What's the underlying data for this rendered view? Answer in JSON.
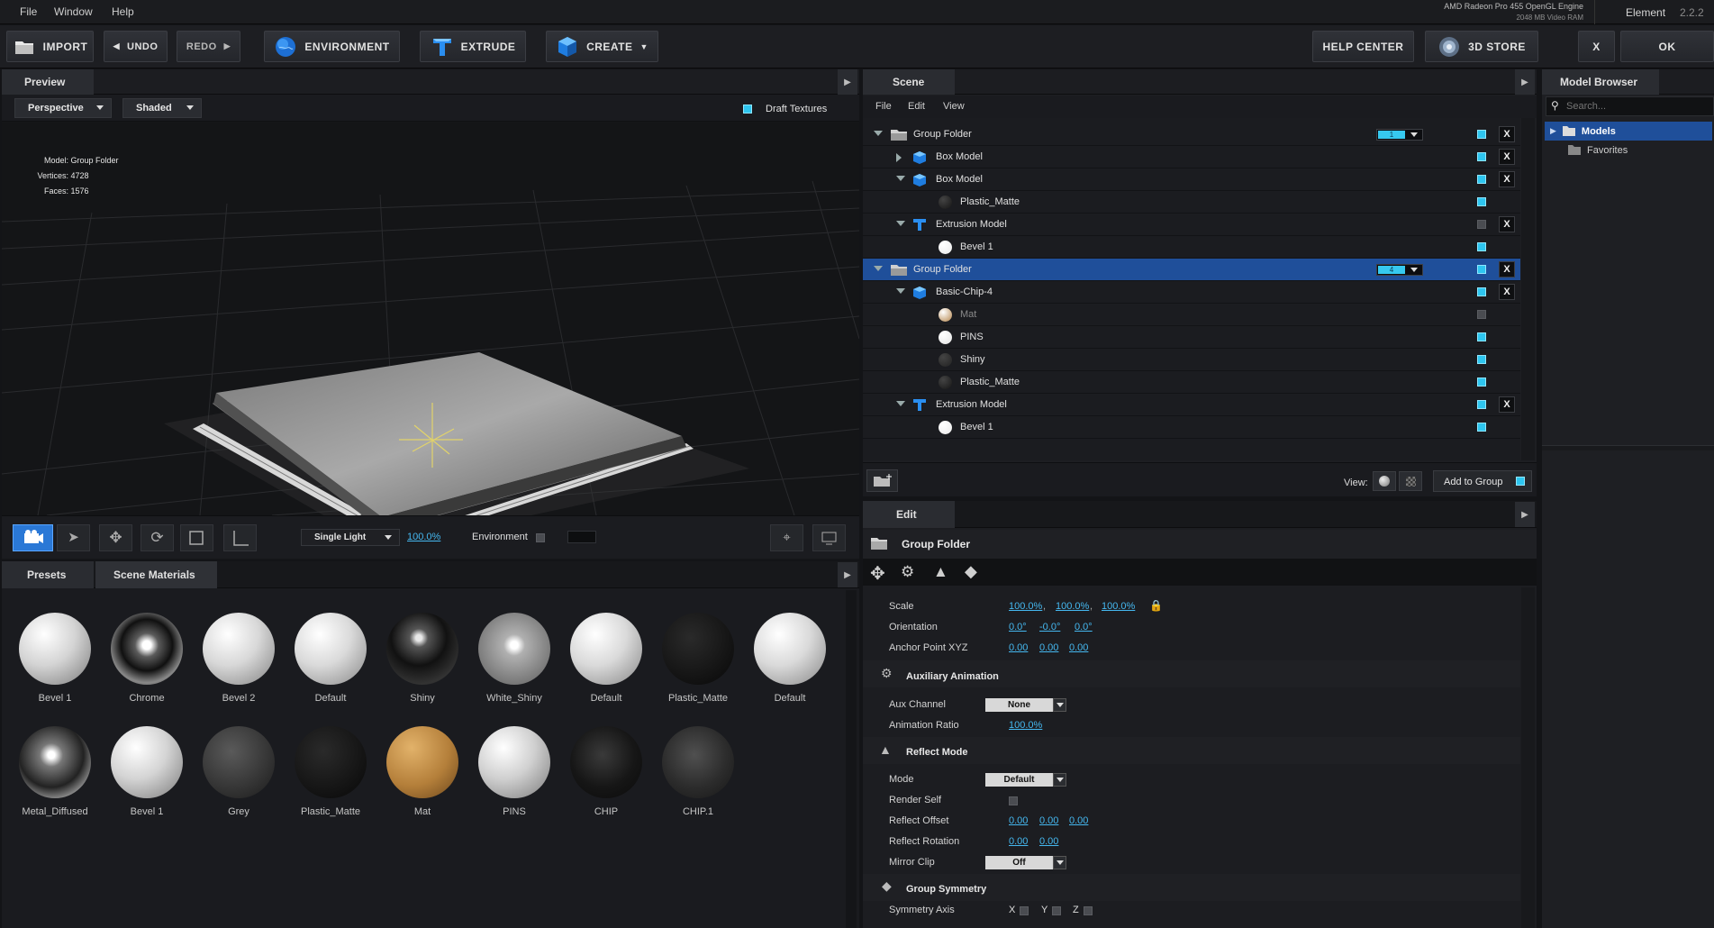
{
  "menubar": {
    "items": [
      "File",
      "Window",
      "Help"
    ],
    "gpu_name": "AMD Radeon Pro 455 OpenGL Engine",
    "gpu_ram": "2048 MB Video RAM",
    "app_name": "Element",
    "app_version": "2.2.2"
  },
  "toolbar": {
    "import": "IMPORT",
    "undo": "UNDO",
    "redo": "REDO",
    "environment": "ENVIRONMENT",
    "extrude": "EXTRUDE",
    "create": "CREATE",
    "help_center": "HELP CENTER",
    "store": "3D STORE",
    "close": "X",
    "ok": "OK"
  },
  "preview": {
    "tab": "Preview",
    "camera": "Perspective",
    "shading": "Shaded",
    "draft_textures": "Draft Textures",
    "info": {
      "model_label": "Model:",
      "model_value": "Group Folder",
      "vertices_label": "Vertices:",
      "vertices_value": "4728",
      "faces_label": "Faces:",
      "faces_value": "1576"
    },
    "lighting": "Single Light",
    "light_percent": "100.0%",
    "environment_label": "Environment"
  },
  "presets": {
    "tabs": [
      "Presets",
      "Scene Materials"
    ],
    "materials_row1": [
      "Bevel 1",
      "Chrome",
      "Bevel 2",
      "Default",
      "Shiny",
      "White_Shiny",
      "Default",
      "Plastic_Matte",
      "Default"
    ],
    "materials_row2": [
      "Metal_Diffused",
      "Bevel 1",
      "Grey",
      "Plastic_Matte",
      "Mat",
      "PINS",
      "CHIP",
      "CHIP.1"
    ]
  },
  "scene": {
    "tab": "Scene",
    "menu": [
      "File",
      "Edit",
      "View"
    ],
    "rows": [
      {
        "label": "Group Folder",
        "badge": "1"
      },
      {
        "label": "Box Model"
      },
      {
        "label": "Box Model"
      },
      {
        "label": "Plastic_Matte"
      },
      {
        "label": "Extrusion Model"
      },
      {
        "label": "Bevel 1"
      },
      {
        "label": "Group Folder",
        "badge": "4"
      },
      {
        "label": "Basic-Chip-4"
      },
      {
        "label": "Mat"
      },
      {
        "label": "PINS"
      },
      {
        "label": "Shiny"
      },
      {
        "label": "Plastic_Matte"
      },
      {
        "label": "Extrusion Model"
      },
      {
        "label": "Bevel 1"
      }
    ],
    "view_label": "View:",
    "add_to_group": "Add to Group"
  },
  "edit": {
    "tab": "Edit",
    "title": "Group Folder",
    "scale_label": "Scale",
    "scale": [
      "100.0%",
      "100.0%",
      "100.0%"
    ],
    "orientation_label": "Orientation",
    "orientation": [
      "0.0°",
      "-0.0°",
      "0.0°"
    ],
    "anchor_label": "Anchor Point XYZ",
    "anchor": [
      "0.00",
      "0.00",
      "0.00"
    ],
    "aux_header": "Auxiliary Animation",
    "aux_channel_label": "Aux Channel",
    "aux_channel": "None",
    "anim_ratio_label": "Animation Ratio",
    "anim_ratio": "100.0%",
    "reflect_header": "Reflect Mode",
    "mode_label": "Mode",
    "mode": "Default",
    "render_self_label": "Render Self",
    "reflect_offset_label": "Reflect Offset",
    "reflect_offset": [
      "0.00",
      "0.00",
      "0.00"
    ],
    "reflect_rotation_label": "Reflect Rotation",
    "reflect_rotation": [
      "0.00",
      "0.00"
    ],
    "mirror_clip_label": "Mirror Clip",
    "mirror_clip": "Off",
    "symmetry_header": "Group Symmetry",
    "symmetry_axis_label": "Symmetry Axis",
    "axes": [
      "X",
      "Y",
      "Z"
    ]
  },
  "model_browser": {
    "tab": "Model Browser",
    "search_placeholder": "Search...",
    "items": [
      "Models",
      "Favorites"
    ]
  }
}
